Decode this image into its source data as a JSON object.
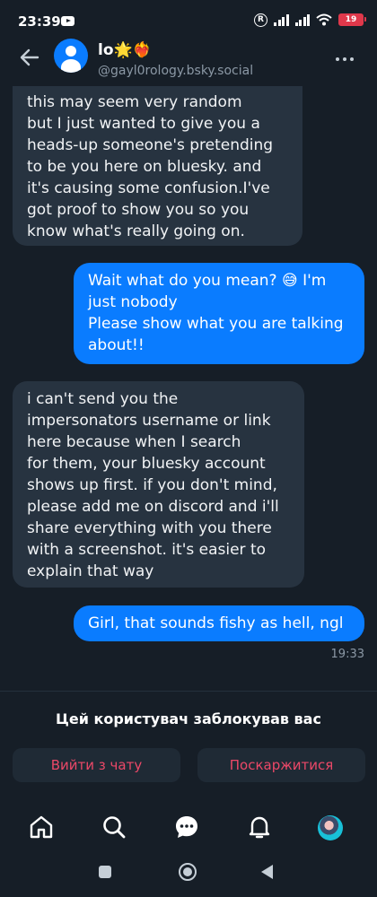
{
  "status_bar": {
    "time": "23:39",
    "r_badge": "R",
    "battery": "19"
  },
  "conversation": {
    "name": "lo🌟❤️‍🔥",
    "handle": "@gayl0rology.bsky.social"
  },
  "messages": [
    {
      "from": "them",
      "text": "this may seem very random\nbut I just wanted to give you a\nheads-up someone's pretending\nto be you here on bluesky. and\nit's causing some confusion.I've\ngot proof to show you so you\nknow what's really going on."
    },
    {
      "from": "me",
      "text": "Wait what do you mean? 😅 I'm\njust nobody\nPlease show what you are talking\nabout!!"
    },
    {
      "from": "them",
      "text": "i can't send you the\nimpersonators username or link\nhere because when I search\nfor them, your bluesky account\nshows up first. if you don't mind,\nplease add me on discord and i'll\nshare everything with you there\nwith a screenshot. it's easier to\nexplain that way"
    },
    {
      "from": "me",
      "text": "Girl, that sounds fishy as hell, ngl"
    }
  ],
  "last_message_time": "19:33",
  "blocked_notice": "Цей користувач заблокував вас",
  "actions": {
    "leave_label": "Вийти з чату",
    "report_label": "Поскаржитися"
  },
  "colors": {
    "background": "#161e27",
    "incoming_bubble": "#273340",
    "outgoing_bubble": "#0a7cff",
    "danger_text": "#ec4868"
  },
  "icons": [
    "back-arrow-icon",
    "more-icon",
    "home-icon",
    "search-icon",
    "chat-icon",
    "bell-icon"
  ]
}
